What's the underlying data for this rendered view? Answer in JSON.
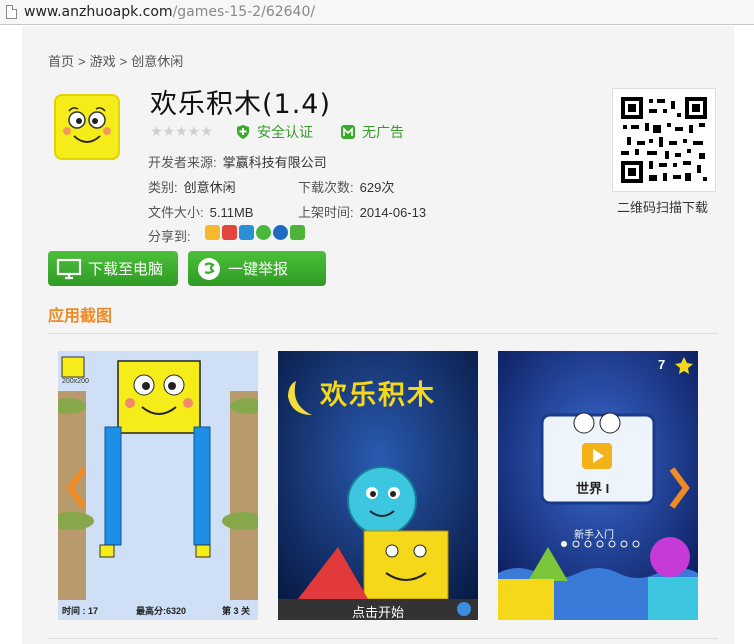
{
  "browser": {
    "url_host": "www.anzhuoapk.com",
    "url_path": "/games-15-2/62640/"
  },
  "breadcrumb": [
    "首页",
    ">",
    "游戏",
    ">",
    "创意休闲"
  ],
  "app": {
    "title": "欢乐积木(1.4)",
    "rating_stars": 0,
    "badges": {
      "safe": "安全认证",
      "no_ads": "无广告"
    },
    "developer_label": "开发者来源:",
    "developer": "掌赢科技有限公司",
    "category_label": "类别:",
    "category": "创意休闲",
    "downloads_label": "下载次数:",
    "downloads": "629次",
    "size_label": "文件大小:",
    "size": "5.11MB",
    "date_label": "上架时间:",
    "date": "2014-06-13",
    "share_label": "分享到:",
    "share_icons": [
      "qzone-icon",
      "weibo-icon",
      "qq-icon",
      "wechat-icon",
      "renren-icon",
      "more-icon"
    ]
  },
  "buttons": {
    "download_pc": "下载至电脑",
    "report": "一键举报"
  },
  "qr": {
    "label": "二维码扫描下载"
  },
  "screenshots_section": {
    "title": "应用截图",
    "shot1": {
      "time_label": "时间 : 17",
      "best_label": "最高分:6320",
      "level_label": "第 3 关",
      "size_tag": "200x200"
    },
    "shot2": {
      "logo_text": "欢乐积木",
      "start_label": "点击开始"
    },
    "shot3": {
      "stars_count": "7",
      "world_label": "世界 I",
      "newbie_label": "新手入门"
    }
  },
  "colors": {
    "accent_orange": "#f08a24",
    "button_green": "#3aaa2c",
    "badge_green": "#3a9b2d"
  }
}
